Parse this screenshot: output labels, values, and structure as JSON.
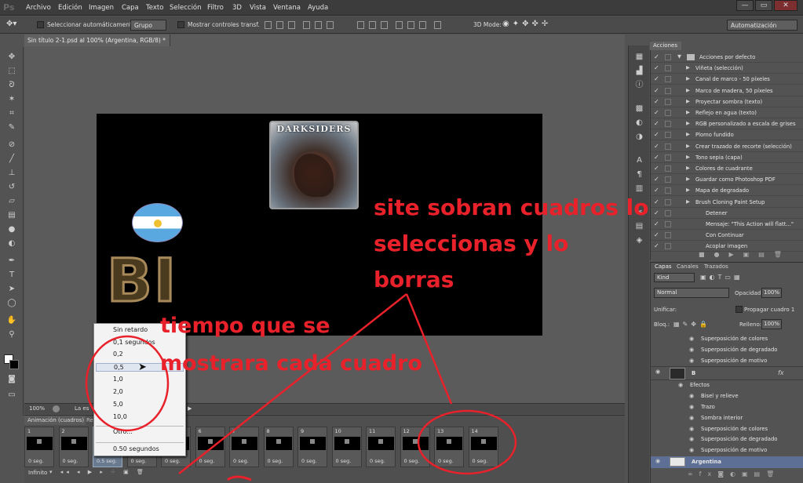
{
  "app": {
    "logo": "Ps"
  },
  "menu": [
    "Archivo",
    "Edición",
    "Imagen",
    "Capa",
    "Texto",
    "Selección",
    "Filtro",
    "3D",
    "Vista",
    "Ventana",
    "Ayuda"
  ],
  "window_buttons": [
    "—",
    "▭",
    "✕"
  ],
  "options": {
    "auto_select_label": "Seleccionar automáticamente:",
    "auto_select_value": "Grupo",
    "show_transform_label": "Mostrar controles transf.",
    "mode_3d_label": "3D Mode:",
    "workspace": "Automatización"
  },
  "document": {
    "tab_title": "Sin título 2-1.psd al 100% (Argentina, RGB/8) *",
    "zoom": "100%",
    "status_text": "La es"
  },
  "canvas": {
    "darksiders_title": "DARKSIDERS",
    "bi_text": "BI"
  },
  "animation": {
    "tab_label": "Animación (cuadros)",
    "tab2_label": "Re",
    "loop": "Infinito",
    "frames": [
      {
        "num": "1",
        "time": "0 seg."
      },
      {
        "num": "2",
        "time": "0 seg."
      },
      {
        "num": "3",
        "time": "0.5 seg."
      },
      {
        "num": "4",
        "time": "0 seg."
      },
      {
        "num": "5",
        "time": "0 seg."
      },
      {
        "num": "6",
        "time": "0 seg."
      },
      {
        "num": "7",
        "time": "0 seg."
      },
      {
        "num": "8",
        "time": "0 seg."
      },
      {
        "num": "9",
        "time": "0 seg."
      },
      {
        "num": "10",
        "time": "0 seg."
      },
      {
        "num": "11",
        "time": "0 seg."
      },
      {
        "num": "12",
        "time": "0 seg."
      },
      {
        "num": "13",
        "time": "0 seg."
      },
      {
        "num": "14",
        "time": "0 seg."
      }
    ]
  },
  "delay_menu": {
    "items": [
      "Sin retardo",
      "0,1 segundos",
      "0,2",
      "0,5",
      "1,0",
      "2,0",
      "5,0",
      "10,0",
      "Otro...",
      "0.50 segundos"
    ],
    "selected_index": 3
  },
  "actions": {
    "tab": "Acciones",
    "rows": [
      {
        "label": "Acciones por defecto",
        "level": 0,
        "folder": true
      },
      {
        "label": "Viñeta (selección)",
        "level": 1
      },
      {
        "label": "Canal de marco - 50 píxeles",
        "level": 1
      },
      {
        "label": "Marco de madera, 50 píxeles",
        "level": 1
      },
      {
        "label": "Proyectar sombra (texto)",
        "level": 1
      },
      {
        "label": "Reflejo en agua (texto)",
        "level": 1
      },
      {
        "label": "RGB personalizado a escala de grises",
        "level": 1
      },
      {
        "label": "Plomo fundido",
        "level": 1
      },
      {
        "label": "Crear trazado de recorte (selección)",
        "level": 1
      },
      {
        "label": "Tono sepia (capa)",
        "level": 1
      },
      {
        "label": "Colores de cuadrante",
        "level": 1
      },
      {
        "label": "Guardar como Photoshop PDF",
        "level": 1
      },
      {
        "label": "Mapa de degradado",
        "level": 1
      },
      {
        "label": "Brush Cloning Paint Setup",
        "level": 1
      },
      {
        "label": "Detener",
        "level": 2
      },
      {
        "label": "Mensaje: \"This Action will flatt...\"",
        "level": 2
      },
      {
        "label": "Con Continuar",
        "level": 2
      },
      {
        "label": "Acoplar imagen",
        "level": 2
      }
    ]
  },
  "layers": {
    "tabs": [
      "Capas",
      "Canales",
      "Trazados"
    ],
    "kind": "Kind",
    "blend": "Normal",
    "opacity_label": "Opacidad:",
    "opacity": "100%",
    "unify_label": "Unificar:",
    "propagate_label": "Propagar cuadro 1",
    "lock_label": "Bloq.:",
    "fill_label": "Relleno:",
    "fill": "100%",
    "rows": [
      {
        "label": "Superposición de colores",
        "kind": "effect"
      },
      {
        "label": "Superposición de degradado",
        "kind": "effect"
      },
      {
        "label": "Superposición de motivo",
        "kind": "effect"
      },
      {
        "label": "B",
        "kind": "layer"
      },
      {
        "label": "Efectos",
        "kind": "effects"
      },
      {
        "label": "Bisel y relieve",
        "kind": "effect"
      },
      {
        "label": "Trazo",
        "kind": "effect"
      },
      {
        "label": "Sombra interior",
        "kind": "effect"
      },
      {
        "label": "Superposición de colores",
        "kind": "effect"
      },
      {
        "label": "Superposición de degradado",
        "kind": "effect"
      },
      {
        "label": "Superposición de motivo",
        "kind": "effect"
      },
      {
        "label": "Argentina",
        "kind": "selected"
      }
    ]
  },
  "annotations": {
    "top_line1": "site sobran cuadros lo",
    "top_line2": "seleccionas y lo",
    "top_line3": "borras",
    "mid_line1": "tiempo que se",
    "mid_line2": "mostrara cada cuadro",
    "color": "#e8212a"
  }
}
